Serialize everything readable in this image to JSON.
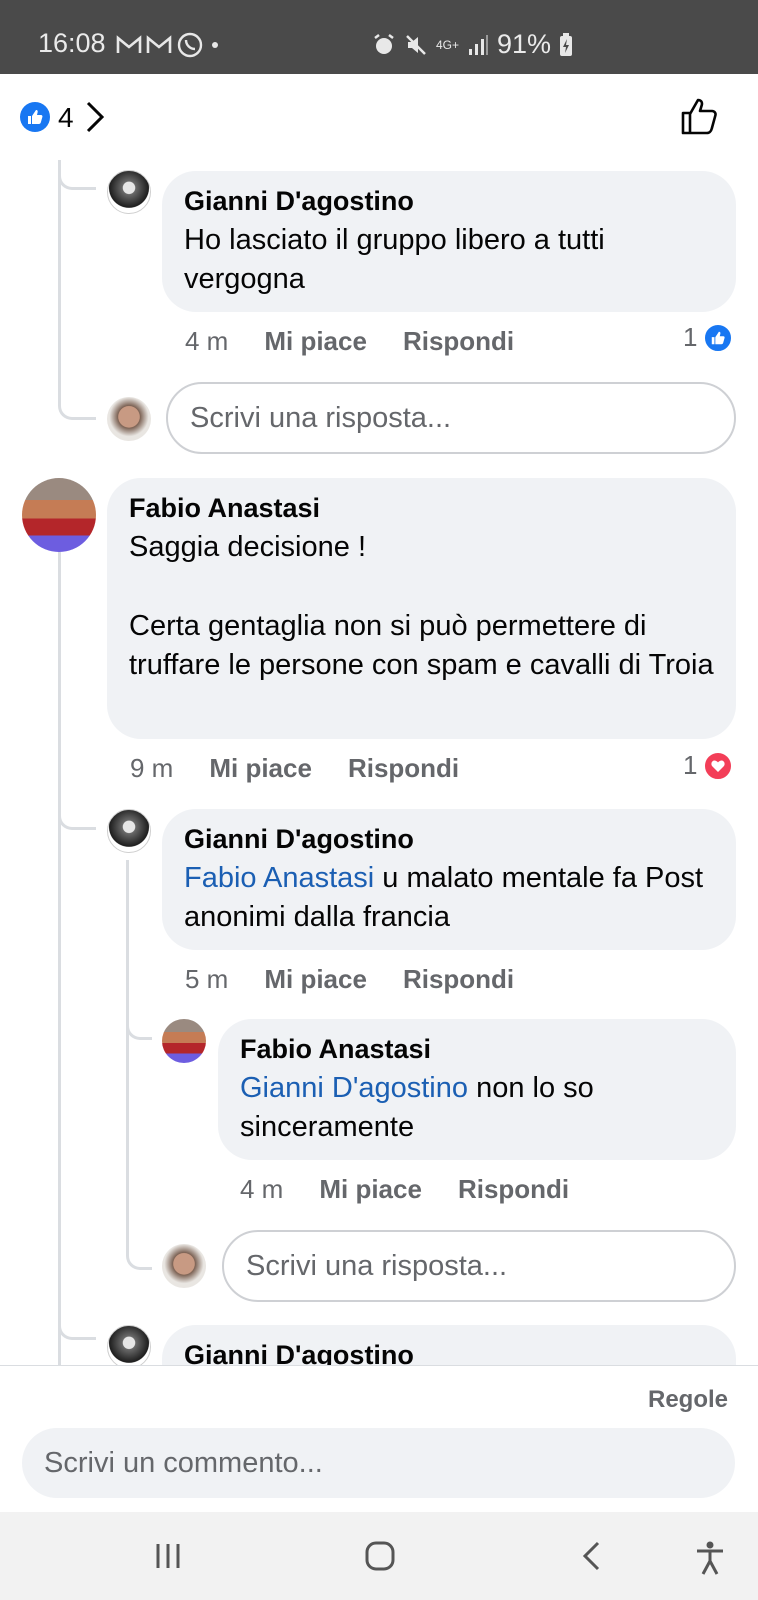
{
  "status_bar": {
    "time": "16:08",
    "network": "4G+",
    "battery": "91%",
    "icons": [
      "gmail-icon",
      "gmail-icon",
      "whatsapp-icon",
      "dot-icon",
      "alarm-icon",
      "mute-icon",
      "signal-icon",
      "battery-charging-icon"
    ]
  },
  "header": {
    "reaction_count": "4",
    "icons": [
      "like-badge-icon",
      "chevron-right-icon",
      "thumbs-up-outline-icon"
    ]
  },
  "comments": [
    {
      "author": "Gianni D'agostino",
      "text": "Ho lasciato il gruppo libero a tutti vergogna",
      "time": "4 m",
      "like_label": "Mi piace",
      "reply_label": "Rispondi",
      "reactions": {
        "count": "1",
        "type": "like"
      }
    },
    {
      "author": "Fabio Anastasi",
      "text_line1": "Saggia decisione !",
      "text_line2": "Certa gentaglia non si può permettere di truffare le persone con spam e cavalli di Troia",
      "time": "9 m",
      "like_label": "Mi piace",
      "reply_label": "Rispondi",
      "reactions": {
        "count": "1",
        "type": "love"
      }
    },
    {
      "author": "Gianni D'agostino",
      "mention": "Fabio Anastasi",
      "text": " u malato mentale fa Post anonimi dalla francia",
      "time": "5 m",
      "like_label": "Mi piace",
      "reply_label": "Rispondi"
    },
    {
      "author": "Fabio Anastasi",
      "mention": "Gianni D'agostino",
      "text": " non lo so sinceramente",
      "time": "4 m",
      "like_label": "Mi piace",
      "reply_label": "Rispondi"
    },
    {
      "author": "Gianni D'agostino"
    }
  ],
  "reply_placeholder": "Scrivi una risposta...",
  "composer": {
    "rules_label": "Regole",
    "placeholder": "Scrivi un commento..."
  },
  "nav_icons": [
    "recent-apps-icon",
    "home-icon",
    "back-icon",
    "accessibility-icon"
  ],
  "colors": {
    "accent": "#1877f2",
    "love": "#f33e58",
    "bubble": "#f0f2f5",
    "mention": "#1b5fb3",
    "muted": "#65676b"
  }
}
